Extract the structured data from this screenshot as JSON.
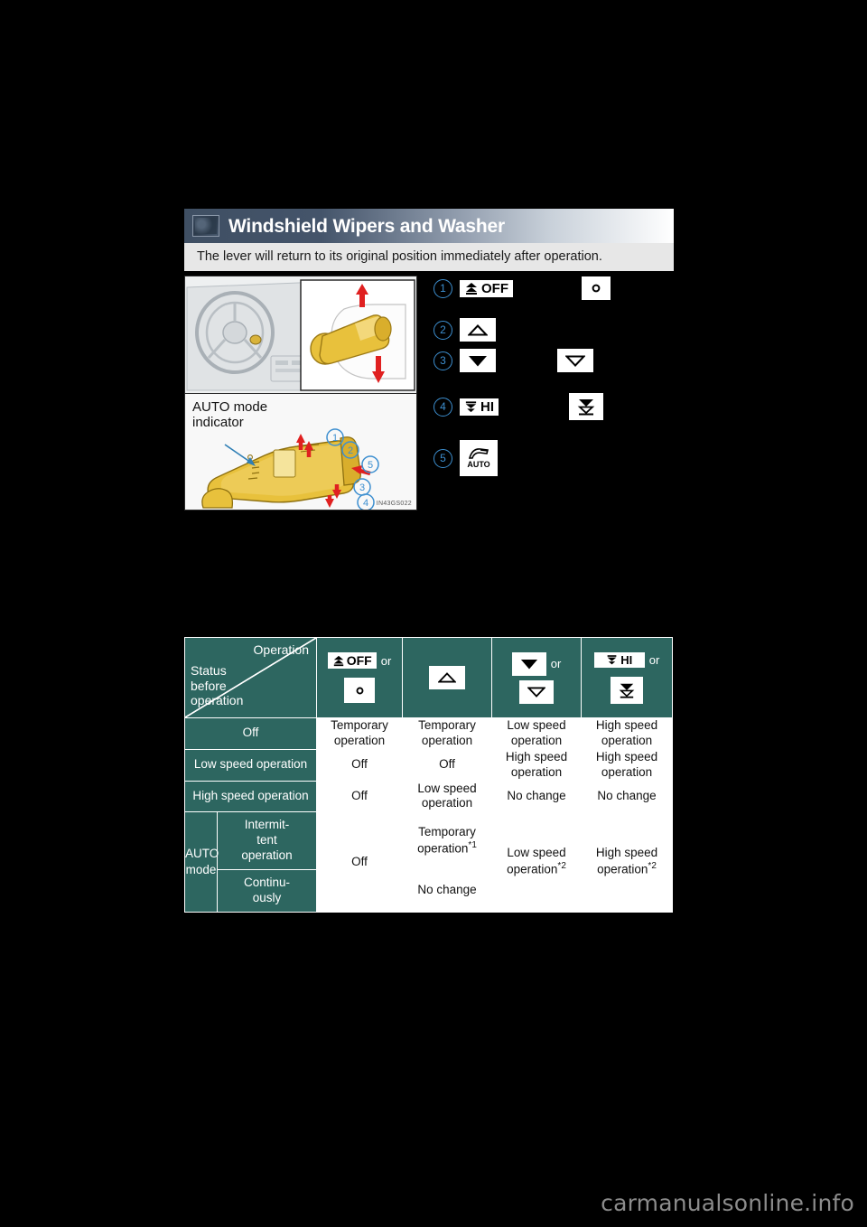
{
  "section": {
    "title": "Windshield Wipers and Washer",
    "subtitle": "The lever will return to its original position immediately after operation.",
    "thumb_icon": "wiper-lever-thumbnail-icon"
  },
  "figure": {
    "auto_mode_label": "AUTO mode\nindicator",
    "auto_mode_label_line1": "AUTO mode",
    "auto_mode_label_line2": "indicator",
    "figure_code": "IN43GS022",
    "callouts": [
      "1",
      "2",
      "3",
      "4",
      "5"
    ]
  },
  "legend": {
    "items": [
      {
        "num": "1",
        "chip": "MIST OFF",
        "chip_text": "OFF",
        "icon": "wiper-mist-off-icon",
        "label": "",
        "alt_chip": "○",
        "alt_icon": "washer-dot-icon"
      },
      {
        "num": "2",
        "chip": "",
        "chip_text": "",
        "icon": "triangle-up-outline-icon",
        "label": "",
        "alt_chip": "",
        "alt_icon": ""
      },
      {
        "num": "3",
        "chip": "",
        "chip_text": "",
        "icon": "triangle-down-filled-icon",
        "label": "",
        "alt_chip": "",
        "alt_icon": "triangle-down-outline-icon"
      },
      {
        "num": "4",
        "chip": "HI",
        "chip_text": "HI",
        "icon": "wiper-hi-icon",
        "label": "",
        "alt_chip": "",
        "alt_icon": "wiper-double-down-icon"
      },
      {
        "num": "5",
        "chip": "AUTO",
        "chip_text": "AUTO",
        "icon": "wiper-auto-icon",
        "label": "",
        "alt_chip": "",
        "alt_icon": ""
      }
    ]
  },
  "table": {
    "corner": {
      "operation_label": "Operation",
      "status_label_line1": "Status",
      "status_label_line2": "before",
      "status_label_line3": "operation"
    },
    "or_word": "or",
    "columns": [
      {
        "icons": [
          "wiper-mist-off-icon",
          "washer-dot-icon"
        ],
        "texts": [
          "OFF",
          "○"
        ],
        "has_or": true
      },
      {
        "icons": [
          "triangle-up-outline-icon"
        ],
        "texts": [
          ""
        ],
        "has_or": false
      },
      {
        "icons": [
          "triangle-down-filled-icon",
          "triangle-down-outline-icon"
        ],
        "texts": [
          "",
          ""
        ],
        "has_or": true
      },
      {
        "icons": [
          "wiper-hi-icon",
          "wiper-double-down-icon"
        ],
        "texts": [
          "HI",
          ""
        ],
        "has_or": true
      }
    ],
    "rows": [
      {
        "head": "Off",
        "cells": [
          "Temporary operation",
          "Temporary operation",
          "Low speed operation",
          "High speed operation"
        ]
      },
      {
        "head": "Low speed operation",
        "cells": [
          "Off",
          "Off",
          "High speed operation",
          "High speed operation"
        ]
      },
      {
        "head": "High speed operation",
        "cells": [
          "Off",
          "Low speed operation",
          "No change",
          "No change"
        ]
      }
    ],
    "auto": {
      "group_label_line1": "AUTO",
      "group_label_line2": "mode",
      "sub_rows": [
        {
          "head_line1": "Intermit-",
          "head_line2": "tent",
          "head_line3": "operation"
        },
        {
          "head_line1": "Continu-",
          "head_line2": "ously"
        }
      ],
      "col1_merged": "Off",
      "col2_row1": "Temporary operation",
      "col2_row1_sup": "*1",
      "col2_row2": "No change",
      "col3_merged": "Low speed operation",
      "col3_sup": "*2",
      "col4_merged": "High speed operation",
      "col4_sup": "*2"
    }
  },
  "watermark": "carmanualsonline.info",
  "colors": {
    "teal": "#2d6660",
    "accent_blue": "#3d8fd0",
    "header_dark": "#44546a",
    "page_bg": "#000000",
    "subtitle_bg": "#e7e7e7"
  }
}
